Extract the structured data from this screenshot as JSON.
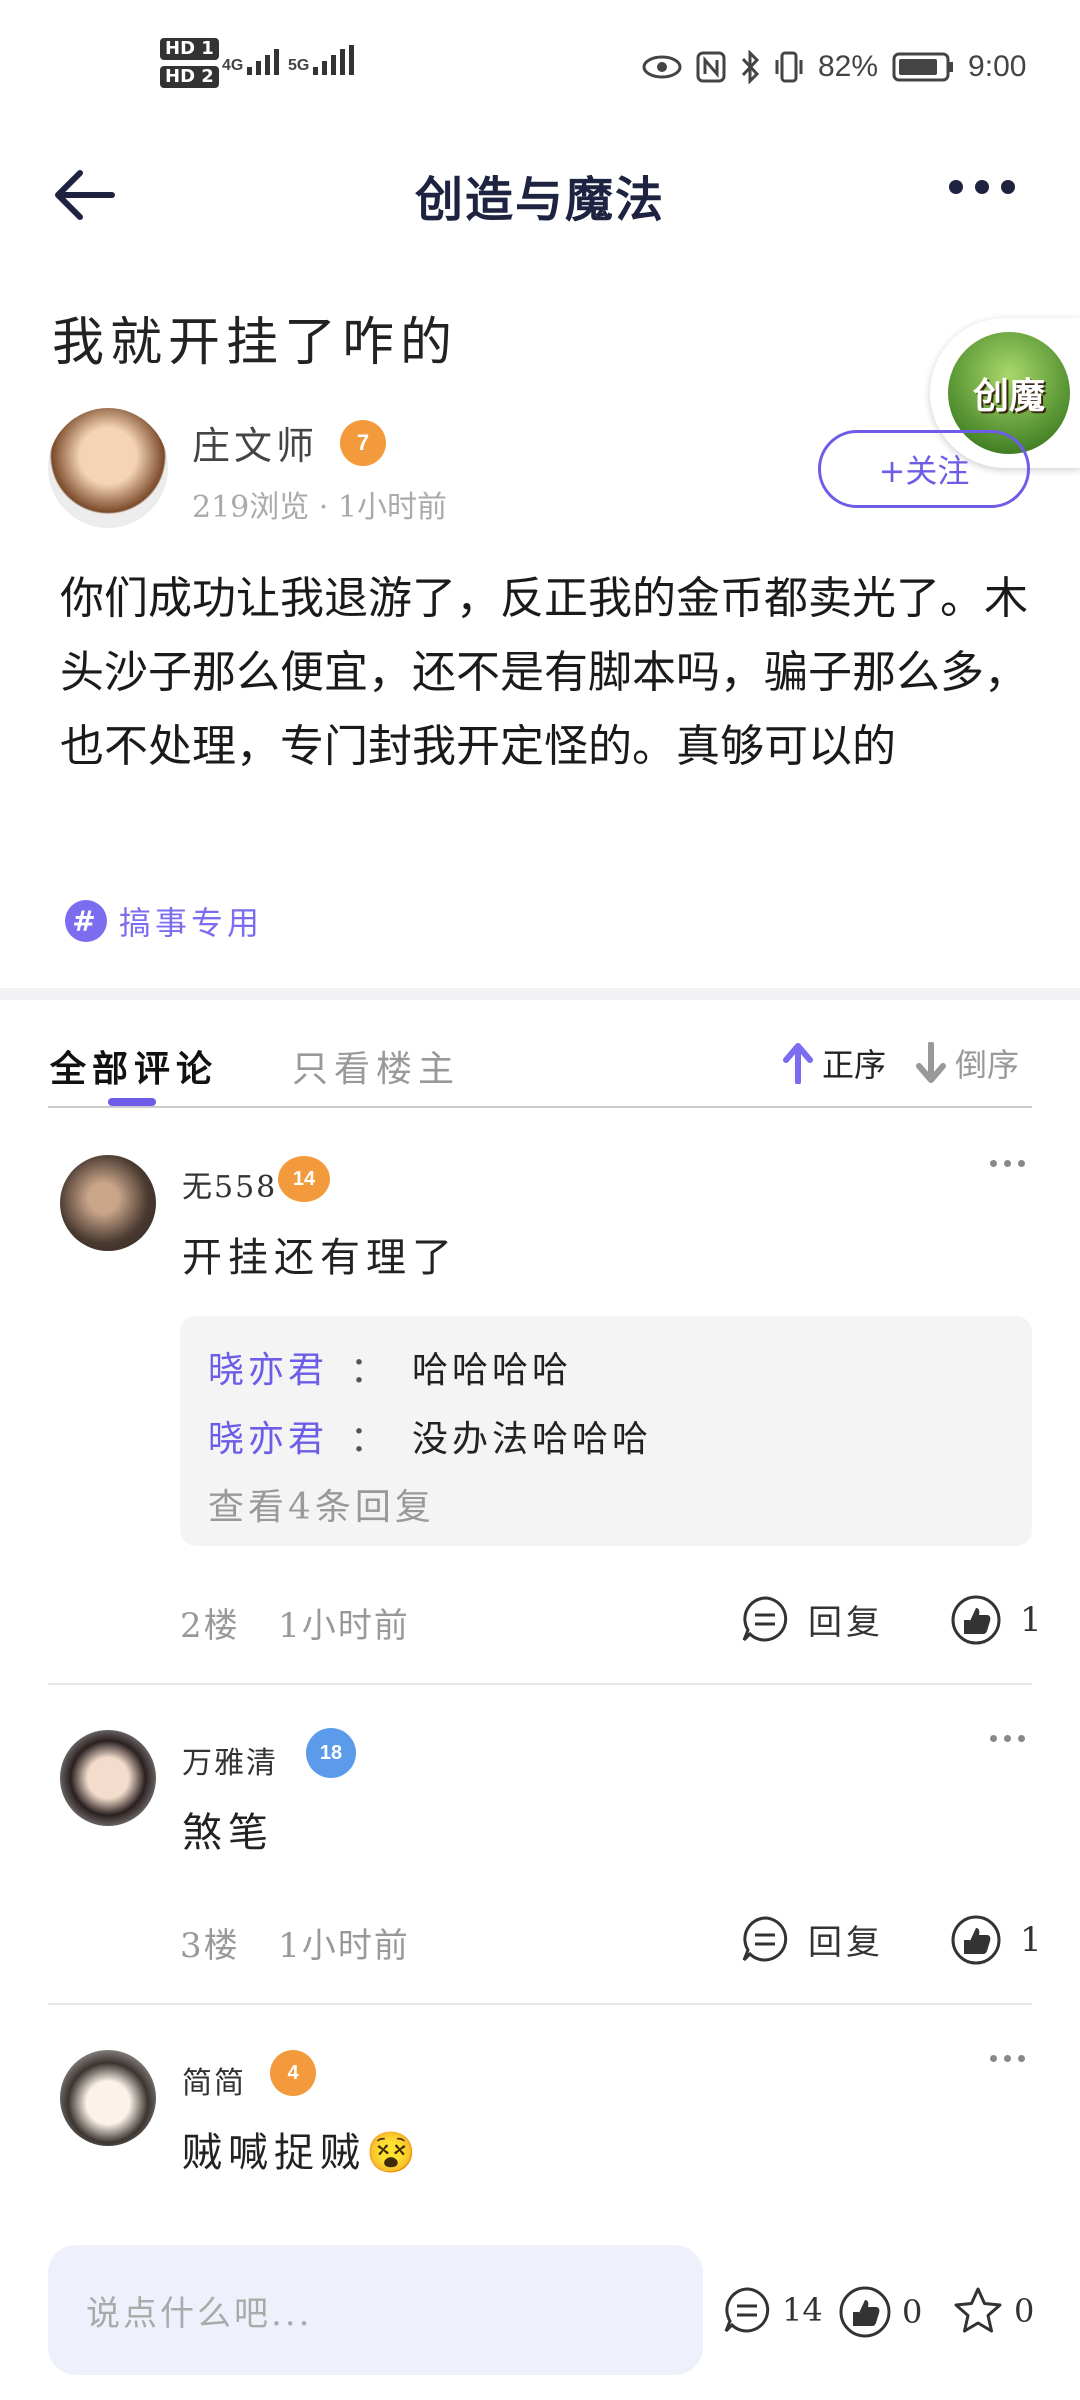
{
  "status_bar": {
    "hd1": "HD 1",
    "hd2": "HD 2",
    "net1": "4G",
    "net2": "5G",
    "battery": "82%",
    "time": "9:00"
  },
  "header": {
    "title": "创造与魔法"
  },
  "post": {
    "title": "我就开挂了咋的",
    "author": {
      "name": "庄文师",
      "level": "7",
      "meta": "219浏览 · 1小时前"
    },
    "follow_label": "+关注",
    "body": "你们成功让我退游了，反正我的金币都卖光了。木头沙子那么便宜，还不是有脚本吗，骗子那么多，也不处理，专门封我开定怪的。真够可以的",
    "tag": "搞事专用",
    "game_badge": "创魔"
  },
  "comment_tabs": {
    "all": "全部评论",
    "owner_only": "只看楼主",
    "sort_asc": "正序",
    "sort_desc": "倒序"
  },
  "comments": [
    {
      "name": "无558",
      "level": "14",
      "text": "开挂还有理了",
      "replies": [
        {
          "name": "晓亦君",
          "sep": "：",
          "text": "哈哈哈哈"
        },
        {
          "name": "晓亦君",
          "sep": "：",
          "text": "没办法哈哈哈"
        }
      ],
      "more_replies": "查看4条回复",
      "floor": "2楼",
      "time": "1小时前",
      "reply_label": "回复",
      "likes": "1"
    },
    {
      "name": "万雅清",
      "level": "18",
      "text": "煞笔",
      "floor": "3楼",
      "time": "1小时前",
      "reply_label": "回复",
      "likes": "1"
    },
    {
      "name": "简简",
      "level": "4",
      "text": "贼喊捉贼",
      "emoji": "😵"
    }
  ],
  "bottom_bar": {
    "placeholder": "说点什么吧...",
    "comment_count": "14",
    "like_count": "0",
    "fav_count": "0"
  },
  "colors": {
    "accent": "#6c5ce7",
    "level_orange": "#f39a3c",
    "level_blue": "#5b9bea",
    "title_navy": "#1d2340"
  }
}
